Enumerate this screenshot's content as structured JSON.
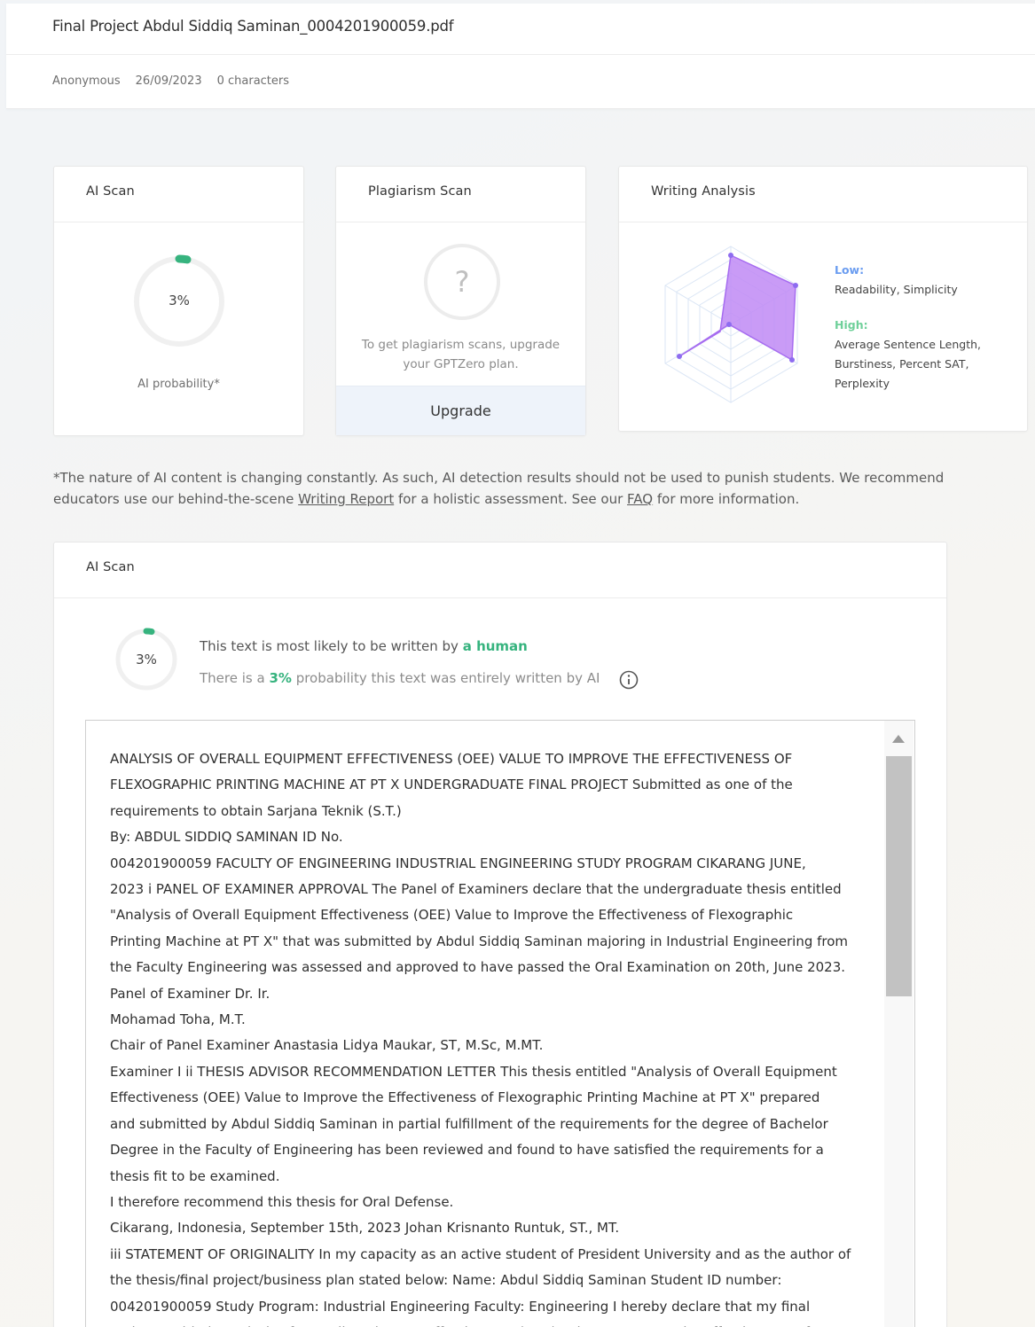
{
  "document": {
    "title": "Final Project Abdul Siddiq Saminan_0004201900059.pdf",
    "author": "Anonymous",
    "date": "26/09/2023",
    "characters": "0 characters"
  },
  "ai_scan_card": {
    "title": "AI Scan",
    "percent": "3%",
    "percent_value": 3,
    "caption": "AI probability*"
  },
  "plagiarism_card": {
    "title": "Plagiarism Scan",
    "icon_glyph": "?",
    "message": "To get plagiarism scans, upgrade your GPTZero plan.",
    "upgrade_label": "Upgrade"
  },
  "writing_card": {
    "title": "Writing Analysis",
    "low_label": "Low:",
    "low_items": "Readability, Simplicity",
    "high_label": "High:",
    "high_items": "Average Sentence Length, Burstiness, Percent SAT, Perplexity",
    "colors": {
      "low": "#6a9cf0",
      "high": "#6fd09a",
      "radar_fill": "#c08af5"
    }
  },
  "disclaimer": {
    "part1": "*The nature of AI content is changing constantly. As such, AI detection results should not be used to punish students. We recommend educators use our behind-the-scene ",
    "writing_report_link": "Writing Report",
    "part2": " for a holistic assessment. See our ",
    "faq_link": "FAQ",
    "part3": " for more information."
  },
  "ai_scan_detail": {
    "title": "AI Scan",
    "percent": "3%",
    "verdict_prefix": "This text is most likely to be written by ",
    "verdict_highlight": "a human",
    "prob_prefix": "There is a ",
    "prob_value": "3%",
    "prob_suffix": " probability this text was entirely written by AI",
    "accent_color": "#36b37e"
  },
  "text_lines": [
    "ANALYSIS OF OVERALL EQUIPMENT EFFECTIVENESS (OEE) VALUE TO IMPROVE THE EFFECTIVENESS OF",
    "FLEXOGRAPHIC PRINTING MACHINE AT PT X UNDERGRADUATE FINAL PROJECT Submitted as one of the",
    "requirements to obtain Sarjana Teknik (S.T.)",
    "By: ABDUL SIDDIQ SAMINAN ID No.",
    "004201900059 FACULTY OF ENGINEERING INDUSTRIAL ENGINEERING STUDY PROGRAM CIKARANG JUNE,",
    "2023 i PANEL OF EXAMINER APPROVAL The Panel of Examiners declare that the undergraduate thesis entitled",
    "\"Analysis of Overall Equipment Effectiveness (OEE) Value to Improve the Effectiveness of Flexographic",
    "Printing Machine at PT X\" that was submitted by Abdul Siddiq Saminan majoring in Industrial Engineering from",
    "the Faculty Engineering was assessed and approved to have passed the Oral Examination on 20th, June 2023.",
    "Panel of Examiner Dr. Ir.",
    "Mohamad Toha, M.T.",
    "Chair of Panel Examiner Anastasia Lidya Maukar, ST, M.Sc, M.MT.",
    "Examiner I ii THESIS ADVISOR RECOMMENDATION LETTER This thesis entitled \"Analysis of Overall Equipment",
    "Effectiveness (OEE) Value to Improve the Effectiveness of Flexographic Printing Machine at PT X\" prepared",
    "and submitted by Abdul Siddiq Saminan in partial fulfillment of the requirements for the degree of Bachelor",
    "Degree in the Faculty of Engineering has been reviewed and found to have satisfied the requirements for a",
    "thesis fit to be examined.",
    "I therefore recommend this thesis for Oral Defense.",
    "Cikarang, Indonesia, September 15th, 2023 Johan Krisnanto Runtuk, ST., MT.",
    "iii STATEMENT OF ORIGINALITY In my capacity as an active student of President University and as the author of",
    "the thesis/final project/business plan stated below: Name: Abdul Siddiq Saminan Student ID number:",
    "004201900059 Study Program: Industrial Engineering Faculty: Engineering I hereby declare that my final",
    "project entitled \"Analysis of Overall Equipment Effectiveness (OEE) Value to Improve the Effectiveness of"
  ]
}
